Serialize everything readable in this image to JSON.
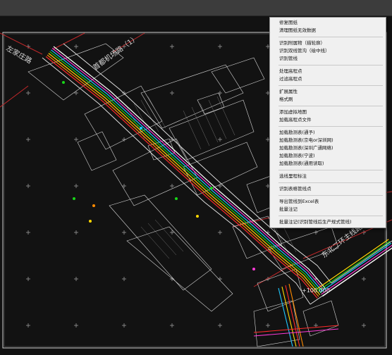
{
  "colors": {
    "background": "#121212",
    "topbar": "#3c3c3c",
    "frame_border": "#d0d0d0",
    "road_lines": "#e6e6e6",
    "red_boundary": "#c0282a",
    "pipe_colors": [
      "#ff2a2a",
      "#ff8a00",
      "#ffd800",
      "#19d619",
      "#1ec8ff",
      "#ff3ad8",
      "#ffffff"
    ],
    "menu_bg": "#f0f0f0",
    "menu_text": "#111111"
  },
  "drawing": {
    "road_labels": {
      "road_1": "左家庄路",
      "road_2": "首都机场路（1）",
      "road_3": "东北二环主线路"
    },
    "elevation_label": "+100.000"
  },
  "context_menu": {
    "groups": [
      {
        "items": [
          "修复图纸",
          "清理图纸无效数据"
        ]
      },
      {
        "items": [
          "识别附属物（描轮廓）",
          "识别双线管沟（绘中线）",
          "识别管线"
        ]
      },
      {
        "items": [
          "处理高程点",
          "过滤高程点"
        ]
      },
      {
        "items": [
          "扩展属性",
          "格式刷"
        ]
      },
      {
        "items": [
          "添加虚拟地图",
          "加载高程点文件"
        ]
      },
      {
        "items": [
          "加载勘测表(通予)",
          "加载勘测表(京电or深圳网)",
          "加载勘测表(深圳广通网络)",
          "加载勘测表(宁波)",
          "加载勘测表(通用读取)"
        ]
      },
      {
        "items": [
          "选线里程标注"
        ]
      },
      {
        "items": [
          "识别表格管线点"
        ]
      },
      {
        "items": [
          "导出管线到Excel表",
          "批量注记"
        ]
      },
      {
        "items": [
          "批量注记(识别管线后生产规式管线)"
        ]
      }
    ]
  }
}
